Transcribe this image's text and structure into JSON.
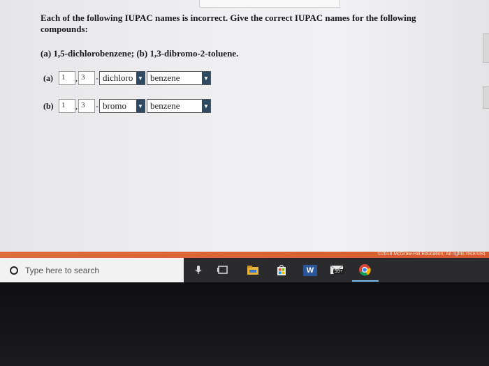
{
  "question": {
    "text": "Each of the following IUPAC names is incorrect. Give the correct IUPAC names for the following compounds:",
    "sub": "(a) 1,5-dichlorobenzene; (b) 1,3-dibromo-2-toluene."
  },
  "answers": [
    {
      "label": "(a)",
      "locant1": "1",
      "locant2": "3",
      "substituent": "dichloro",
      "parent": "benzene"
    },
    {
      "label": "(b)",
      "locant1": "1",
      "locant2": "3",
      "substituent": "bromo",
      "parent": "benzene"
    }
  ],
  "separators": {
    "comma": ",",
    "dash": "-"
  },
  "footer": {
    "copyright": "©2018 McGraw-Hill Education. All rights reserved."
  },
  "taskbar": {
    "search_placeholder": "Type here to search",
    "mail_badge": "99+",
    "word_label": "W"
  },
  "colors": {
    "accent_strip": "#d75a2e",
    "dropdown_arrow": "#2e4a63",
    "taskbar": "#2b2b2d"
  }
}
